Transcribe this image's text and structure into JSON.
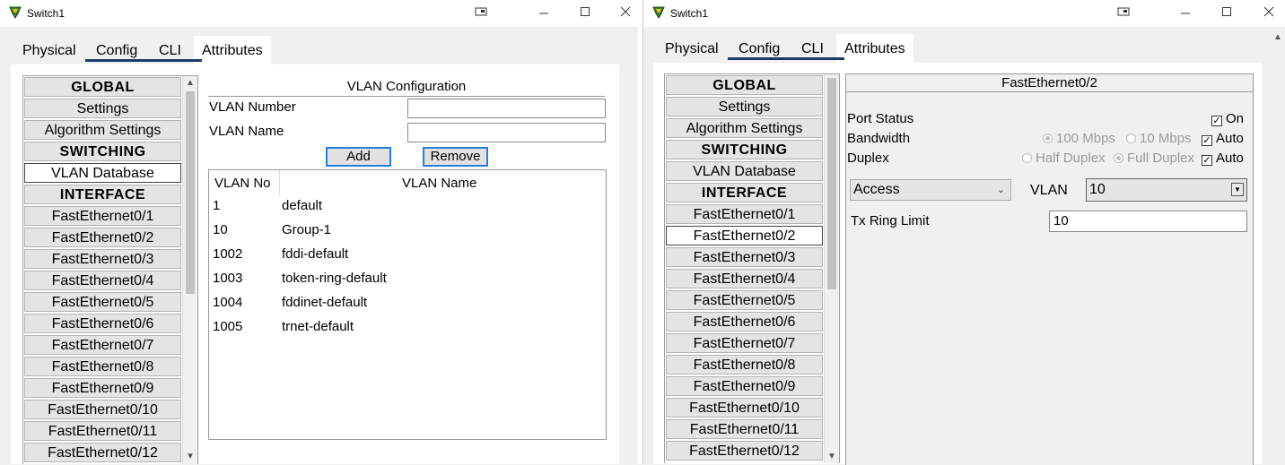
{
  "left_window": {
    "title": "Switch1",
    "tabs": [
      "Physical",
      "Config",
      "CLI",
      "Attributes"
    ],
    "active_tab": "Config",
    "nav": [
      {
        "label": "GLOBAL",
        "header": true
      },
      {
        "label": "Settings"
      },
      {
        "label": "Algorithm Settings"
      },
      {
        "label": "SWITCHING",
        "header": true
      },
      {
        "label": "VLAN Database",
        "selected": true
      },
      {
        "label": "INTERFACE",
        "header": true
      },
      {
        "label": "FastEthernet0/1"
      },
      {
        "label": "FastEthernet0/2"
      },
      {
        "label": "FastEthernet0/3"
      },
      {
        "label": "FastEthernet0/4"
      },
      {
        "label": "FastEthernet0/5"
      },
      {
        "label": "FastEthernet0/6"
      },
      {
        "label": "FastEthernet0/7"
      },
      {
        "label": "FastEthernet0/8"
      },
      {
        "label": "FastEthernet0/9"
      },
      {
        "label": "FastEthernet0/10"
      },
      {
        "label": "FastEthernet0/11"
      },
      {
        "label": "FastEthernet0/12"
      }
    ],
    "vlan_config": {
      "title": "VLAN Configuration",
      "number_label": "VLAN Number",
      "number_value": "",
      "name_label": "VLAN Name",
      "name_value": "",
      "add_label": "Add",
      "remove_label": "Remove",
      "col_no": "VLAN No",
      "col_name": "VLAN Name",
      "rows": [
        {
          "no": "1",
          "name": "default"
        },
        {
          "no": "10",
          "name": "Group-1"
        },
        {
          "no": "1002",
          "name": "fddi-default"
        },
        {
          "no": "1003",
          "name": "token-ring-default"
        },
        {
          "no": "1004",
          "name": "fddinet-default"
        },
        {
          "no": "1005",
          "name": "trnet-default"
        }
      ]
    }
  },
  "right_window": {
    "title": "Switch1",
    "tabs": [
      "Physical",
      "Config",
      "CLI",
      "Attributes"
    ],
    "active_tab": "Config",
    "nav": [
      {
        "label": "GLOBAL",
        "header": true
      },
      {
        "label": "Settings"
      },
      {
        "label": "Algorithm Settings"
      },
      {
        "label": "SWITCHING",
        "header": true
      },
      {
        "label": "VLAN Database"
      },
      {
        "label": "INTERFACE",
        "header": true
      },
      {
        "label": "FastEthernet0/1"
      },
      {
        "label": "FastEthernet0/2",
        "selected": true
      },
      {
        "label": "FastEthernet0/3"
      },
      {
        "label": "FastEthernet0/4"
      },
      {
        "label": "FastEthernet0/5"
      },
      {
        "label": "FastEthernet0/6"
      },
      {
        "label": "FastEthernet0/7"
      },
      {
        "label": "FastEthernet0/8"
      },
      {
        "label": "FastEthernet0/9"
      },
      {
        "label": "FastEthernet0/10"
      },
      {
        "label": "FastEthernet0/11"
      },
      {
        "label": "FastEthernet0/12"
      }
    ],
    "interface": {
      "title": "FastEthernet0/2",
      "port_status_label": "Port Status",
      "port_status_on_label": "On",
      "bandwidth_label": "Bandwidth",
      "bw_100_label": "100 Mbps",
      "bw_10_label": "10 Mbps",
      "bw_auto_label": "Auto",
      "duplex_label": "Duplex",
      "half_label": "Half Duplex",
      "full_label": "Full Duplex",
      "duplex_auto_label": "Auto",
      "mode_value": "Access",
      "vlan_label": "VLAN",
      "vlan_value": "10",
      "tx_ring_label": "Tx Ring Limit",
      "tx_ring_value": "10"
    }
  },
  "icons": {
    "restore": "restore-icon",
    "minimize": "minimize-icon",
    "maximize": "maximize-icon",
    "close": "close-icon"
  },
  "colors": {
    "tab_underline": "#1d3a66",
    "button_border": "#2a7fd4"
  }
}
